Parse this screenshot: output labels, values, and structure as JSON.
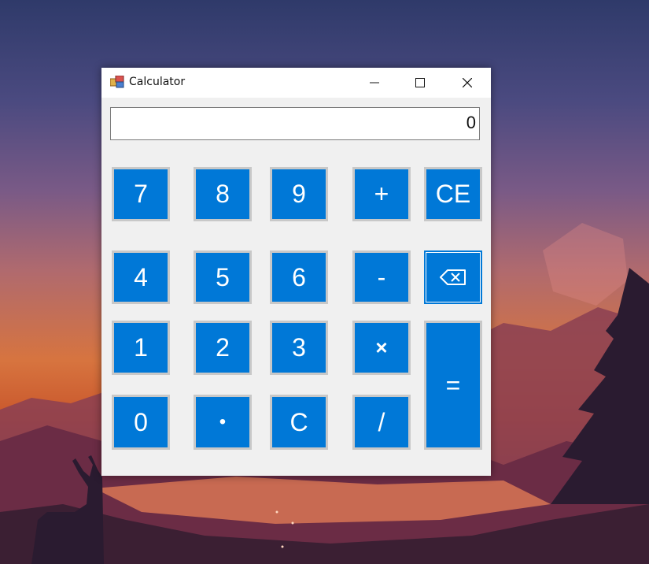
{
  "window": {
    "title": "Calculator",
    "icon": "calculator-app-icon",
    "controls": {
      "minimize": "minimize-icon",
      "maximize": "maximize-icon",
      "close": "close-icon"
    }
  },
  "display": {
    "value": "0"
  },
  "keys": {
    "seven": "7",
    "eight": "8",
    "nine": "9",
    "plus": "+",
    "clear_entry": "CE",
    "four": "4",
    "five": "5",
    "six": "6",
    "minus": "-",
    "backspace_icon": "backspace-icon",
    "one": "1",
    "two": "2",
    "three": "3",
    "multiply": "×",
    "equals": "=",
    "zero": "0",
    "decimal": "•",
    "clear": "C",
    "divide": "/"
  },
  "colors": {
    "key_background": "#0078d7",
    "key_text": "#ffffff",
    "window_background": "#f0f0f0"
  }
}
